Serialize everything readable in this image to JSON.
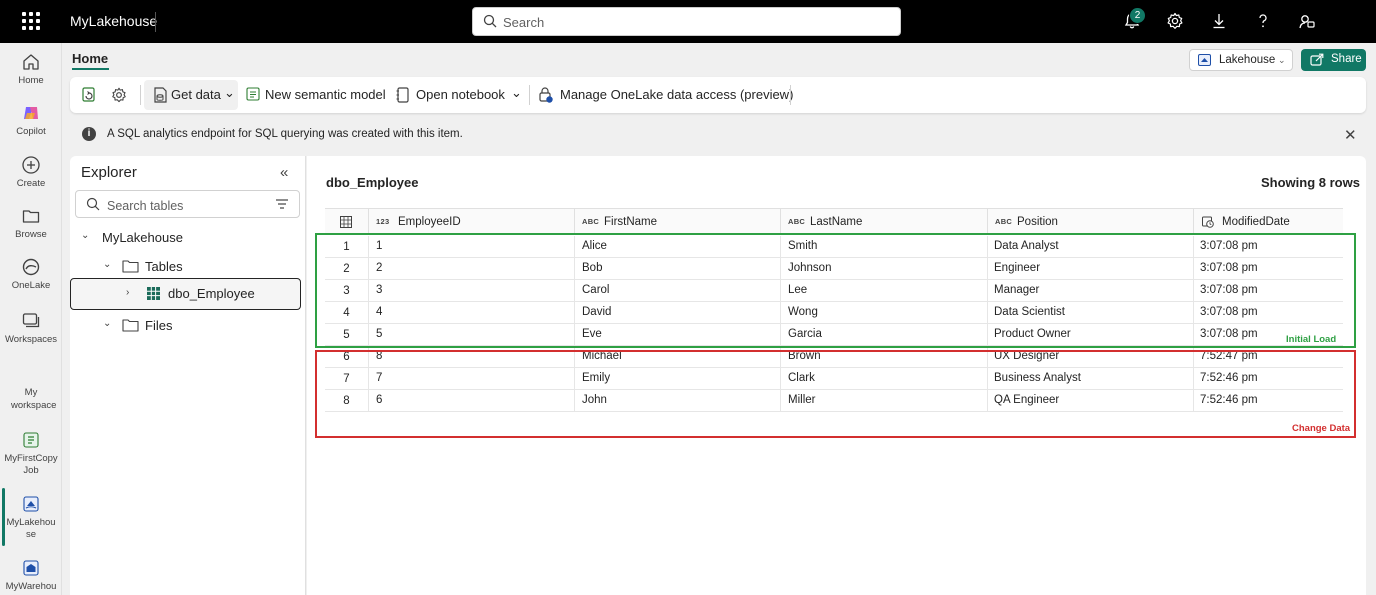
{
  "topbar": {
    "app_title": "MyLakehouse",
    "search_placeholder": "Search",
    "notification_count": "2"
  },
  "rail": {
    "items": [
      {
        "label": "Home",
        "icon": "home-icon"
      },
      {
        "label": "Copilot",
        "icon": "copilot-icon"
      },
      {
        "label": "Create",
        "icon": "plus-circle-icon"
      },
      {
        "label": "Browse",
        "icon": "folder-icon"
      },
      {
        "label": "OneLake",
        "icon": "onelake-icon"
      },
      {
        "label": "Workspaces",
        "icon": "workspaces-icon"
      },
      {
        "label": "My workspace",
        "icon": "my-workspace"
      },
      {
        "label": "MyFirstCopy Job",
        "icon": "copy-job-icon"
      },
      {
        "label": "MyLakehou se",
        "icon": "lakehouse-icon"
      },
      {
        "label": "MyWarehou",
        "icon": "warehouse-icon"
      }
    ]
  },
  "header": {
    "home_tab": "Home",
    "lakehouse_label": "Lakehouse",
    "share_label": "Share"
  },
  "toolbar": {
    "get_data": "Get data",
    "new_semantic_model": "New semantic model",
    "open_notebook": "Open notebook",
    "manage_access": "Manage OneLake data access (preview)"
  },
  "infobar": {
    "message": "A SQL analytics endpoint for SQL querying was created with this item."
  },
  "explorer": {
    "title": "Explorer",
    "search_placeholder": "Search tables",
    "root": "MyLakehouse",
    "tables_folder": "Tables",
    "table_item": "dbo_Employee",
    "files_folder": "Files"
  },
  "main": {
    "table_name": "dbo_Employee",
    "showing": "Showing 8 rows",
    "columns": [
      {
        "type": "123",
        "label": "EmployeeID"
      },
      {
        "type": "ABC",
        "label": "FirstName"
      },
      {
        "type": "ABC",
        "label": "LastName"
      },
      {
        "type": "ABC",
        "label": "Position"
      },
      {
        "type": "clock",
        "label": "ModifiedDate"
      }
    ],
    "rows": [
      {
        "n": "1",
        "id": "1",
        "first": "Alice",
        "last": "Smith",
        "position": "Data Analyst",
        "modified": "3:07:08 pm"
      },
      {
        "n": "2",
        "id": "2",
        "first": "Bob",
        "last": "Johnson",
        "position": "Engineer",
        "modified": "3:07:08 pm"
      },
      {
        "n": "3",
        "id": "3",
        "first": "Carol",
        "last": "Lee",
        "position": "Manager",
        "modified": "3:07:08 pm"
      },
      {
        "n": "4",
        "id": "4",
        "first": "David",
        "last": "Wong",
        "position": "Data Scientist",
        "modified": "3:07:08 pm"
      },
      {
        "n": "5",
        "id": "5",
        "first": "Eve",
        "last": "Garcia",
        "position": "Product Owner",
        "modified": "3:07:08 pm"
      },
      {
        "n": "6",
        "id": "8",
        "first": "Michael",
        "last": "Brown",
        "position": "UX Designer",
        "modified": "7:52:47 pm"
      },
      {
        "n": "7",
        "id": "7",
        "first": "Emily",
        "last": "Clark",
        "position": "Business Analyst",
        "modified": "7:52:46 pm"
      },
      {
        "n": "8",
        "id": "6",
        "first": "John",
        "last": "Miller",
        "position": "QA Engineer",
        "modified": "7:52:46 pm"
      }
    ],
    "annotation_initial": "Initial Load",
    "annotation_change": "Change Data"
  },
  "colors": {
    "accent": "#117865",
    "initial_box": "#2ea043",
    "change_box": "#d32f2f"
  }
}
